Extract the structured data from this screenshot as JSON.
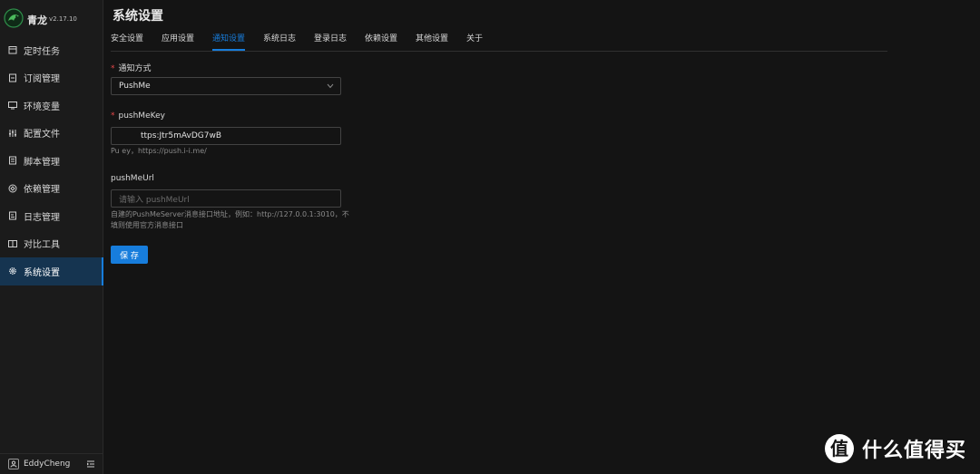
{
  "app": {
    "name": "青龙",
    "version": "v2.17.10"
  },
  "sidebar": {
    "items": [
      {
        "label": "定时任务",
        "icon": "calendar-icon"
      },
      {
        "label": "订阅管理",
        "icon": "subscription-icon"
      },
      {
        "label": "环境变量",
        "icon": "monitor-icon"
      },
      {
        "label": "配置文件",
        "icon": "sliders-icon"
      },
      {
        "label": "脚本管理",
        "icon": "file-icon"
      },
      {
        "label": "依赖管理",
        "icon": "package-icon"
      },
      {
        "label": "日志管理",
        "icon": "log-icon"
      },
      {
        "label": "对比工具",
        "icon": "diff-icon"
      },
      {
        "label": "系统设置",
        "icon": "gear-icon",
        "active": true
      }
    ],
    "user": "EddyCheng"
  },
  "page": {
    "title": "系统设置"
  },
  "tabs": [
    "安全设置",
    "应用设置",
    "通知设置",
    "系统日志",
    "登录日志",
    "依赖设置",
    "其他设置",
    "关于"
  ],
  "active_tab": "通知设置",
  "form": {
    "method_label": "通知方式",
    "method_value": "PushMe",
    "key_label": "pushMeKey",
    "key_value": "ttps:Jtr5mAvDG7wB",
    "key_help": "Pu        ey，https://push.i-i.me/",
    "url_label": "pushMeUrl",
    "url_placeholder": "请输入 pushMeUrl",
    "url_help_1": "自建的PushMeServer消息接口地址，例如：http://127.0.0.1:3010，不",
    "url_help_2": "填则使用官方消息接口",
    "save_label": "保 存"
  },
  "watermark": {
    "text": "什么值得买"
  },
  "colors": {
    "accent": "#177ddc",
    "background": "#141414",
    "sidebar": "#1b1b1b",
    "required": "#e84749"
  }
}
